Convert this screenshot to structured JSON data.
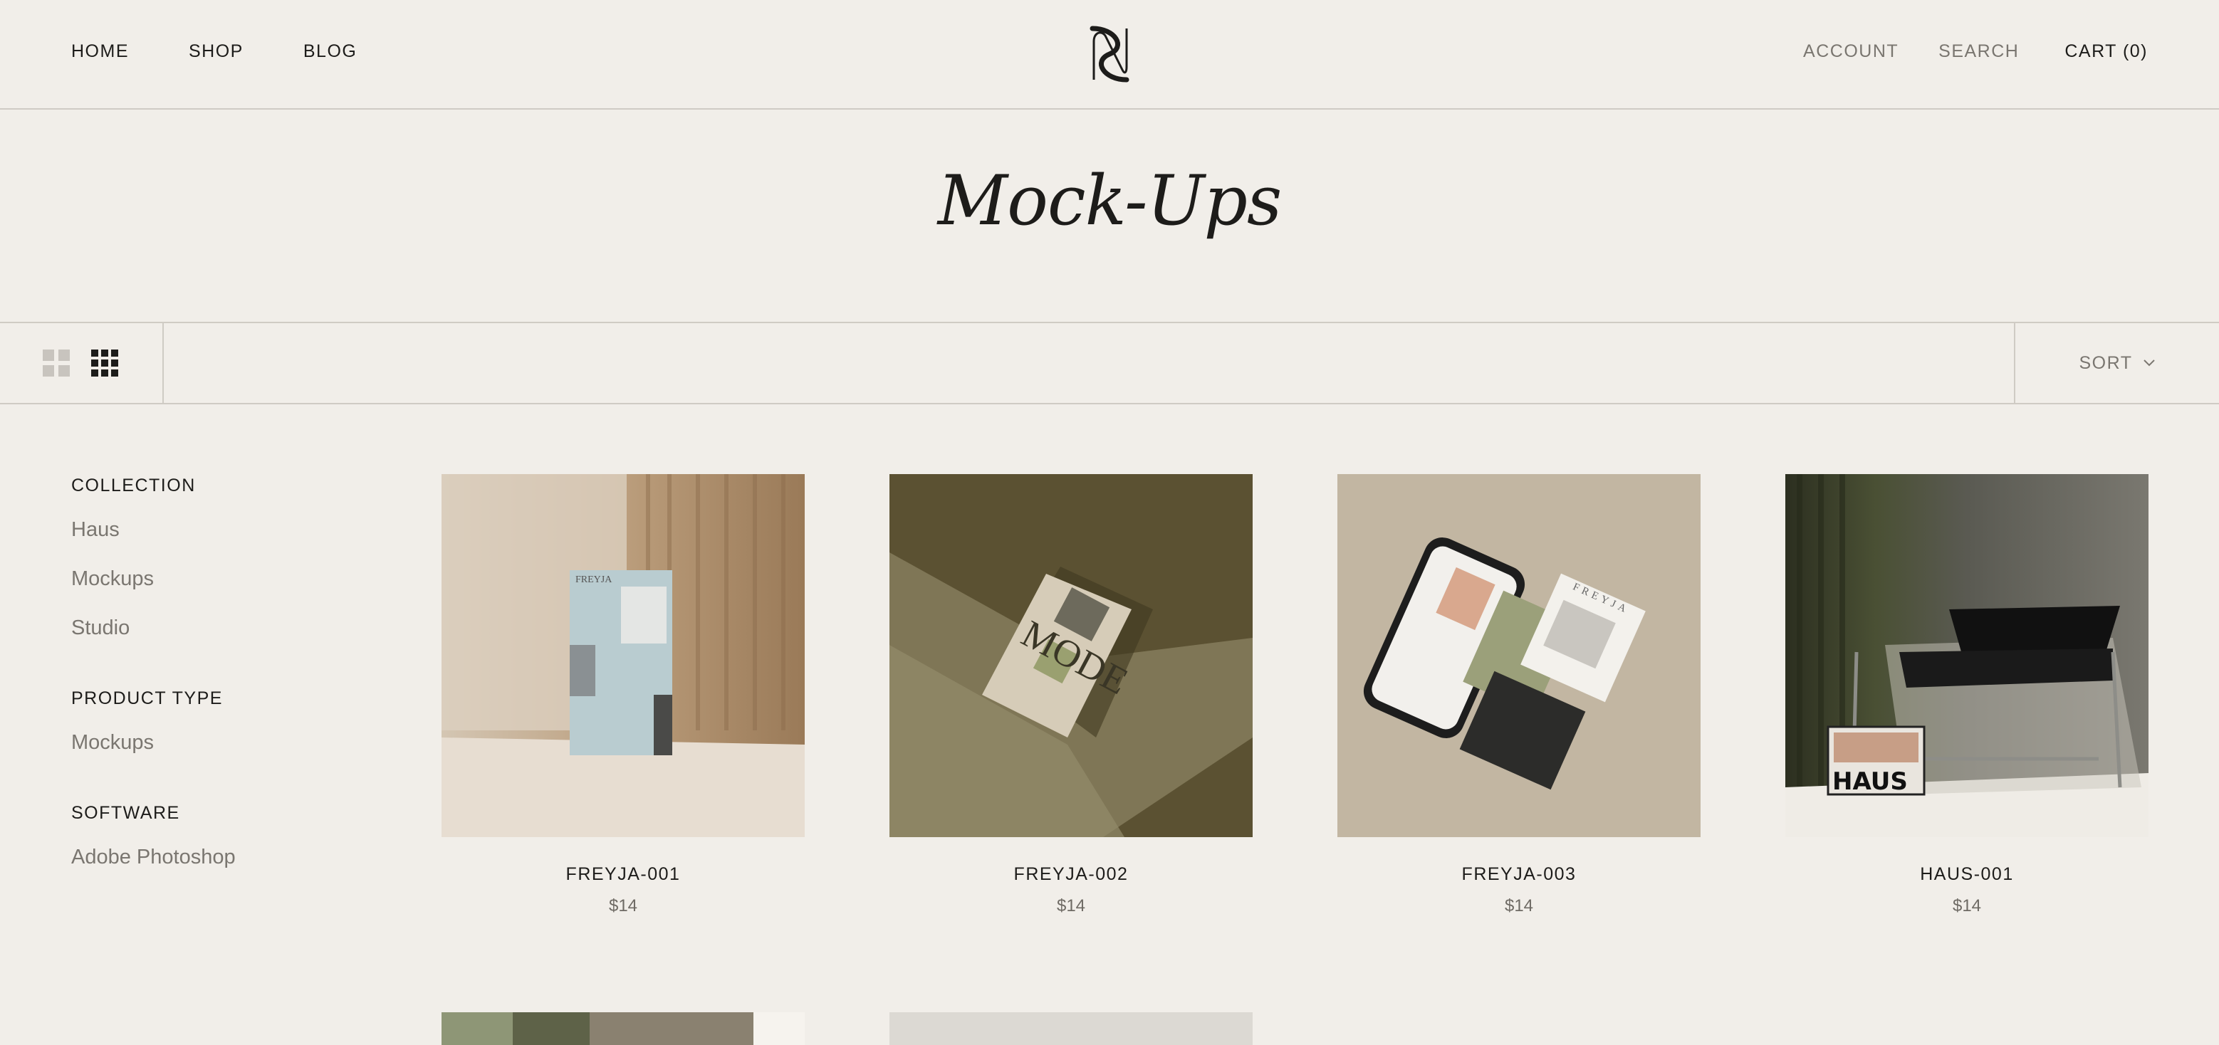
{
  "header": {
    "nav_left": [
      "HOME",
      "SHOP",
      "BLOG"
    ],
    "nav_right": {
      "account": "ACCOUNT",
      "search": "SEARCH",
      "cart": "CART (0)"
    }
  },
  "page": {
    "title": "Mock-Ups"
  },
  "toolbar": {
    "sort_label": "SORT"
  },
  "sidebar": {
    "groups": [
      {
        "heading": "COLLECTION",
        "items": [
          "Haus",
          "Mockups",
          "Studio"
        ]
      },
      {
        "heading": "PRODUCT TYPE",
        "items": [
          "Mockups"
        ]
      },
      {
        "heading": "SOFTWARE",
        "items": [
          "Adobe Photoshop"
        ]
      }
    ]
  },
  "products": [
    {
      "name": "FREYJA-001",
      "price": "$14",
      "thumb_text": "FREYJA"
    },
    {
      "name": "FREYJA-002",
      "price": "$14",
      "thumb_text": "MODE"
    },
    {
      "name": "FREYJA-003",
      "price": "$14",
      "thumb_text": "FREYJA"
    },
    {
      "name": "HAUS-001",
      "price": "$14",
      "thumb_text": "HAUS"
    }
  ],
  "colors": {
    "background": "#f1eee9",
    "text": "#1d1c1a",
    "muted": "#7a7670",
    "divider": "#cfcbc4"
  }
}
